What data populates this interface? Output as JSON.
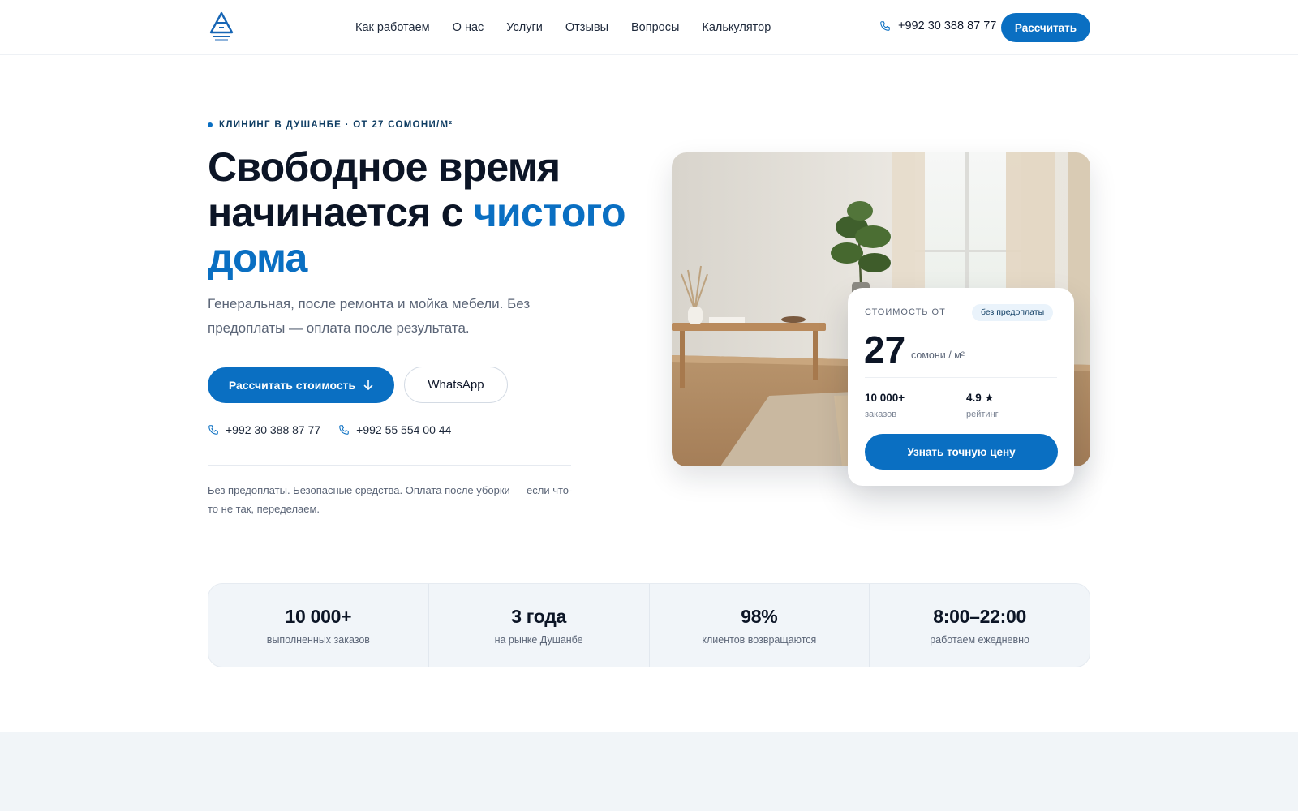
{
  "header": {
    "nav": [
      "Как работаем",
      "О нас",
      "Услуги",
      "Отзывы",
      "Вопросы",
      "Калькулятор"
    ],
    "phone": "+992 30 388 87 77",
    "cta_label": "Рассчитать"
  },
  "hero": {
    "eyebrow": "КЛИНИНГ В ДУШАНБЕ · ОТ 27 СОМОНИ/М²",
    "title_line1": "Свободное время",
    "title_line2": "начинается с ",
    "title_accent_1": "чистого",
    "title_accent_2": "дома",
    "subtitle": "Генеральная, после ремонта и мойка мебели. Без предоплаты — оплата после результата.",
    "cta_label": "Рассчитать стоимость",
    "whatsapp_label": "WhatsApp",
    "phones": [
      "+992 30 388 87 77",
      "+992 55 554 00 44"
    ],
    "note": "Без предоплаты. Безопасные средства. Оплата после уборки — если что-то не так, переделаем."
  },
  "price_card": {
    "label": "СТОИМОСТЬ ОТ",
    "badge": "без предоплаты",
    "price": "27",
    "unit": "сомони / м²",
    "orders_value": "10 000+",
    "orders_label": "заказов",
    "rating_value": "4.9 ★",
    "rating_label": "рейтинг",
    "cta_label": "Узнать точную цену"
  },
  "stats": [
    {
      "value": "10 000+",
      "label": "выполненных заказов"
    },
    {
      "value": "3 года",
      "label": "на рынке Душанбе"
    },
    {
      "value": "98%",
      "label": "клиентов возвращаются"
    },
    {
      "value": "8:00–22:00",
      "label": "работаем ежедневно"
    }
  ],
  "colors": {
    "accent": "#0a6fc2",
    "heading": "#0c1526",
    "muted": "#5b6577",
    "stats_bg": "#f1f5f9"
  },
  "icons": [
    "logo-icon",
    "phone-icon",
    "arrow-down-icon"
  ]
}
